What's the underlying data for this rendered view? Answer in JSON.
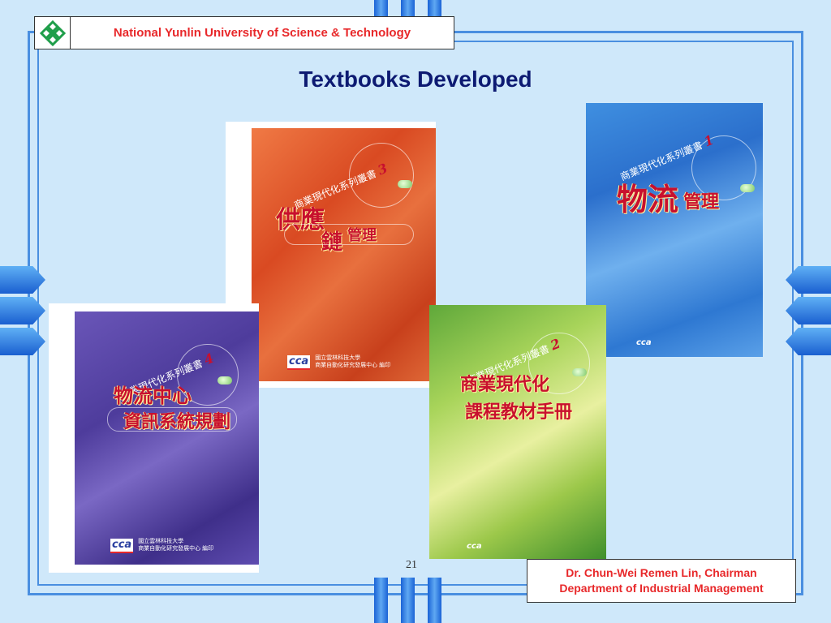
{
  "header": {
    "institution": "National Yunlin University of Science & Technology",
    "logo_icon": "university-flower-logo-icon"
  },
  "title": "Textbooks Developed",
  "books": [
    {
      "series": "商業現代化系列叢書",
      "number": "3",
      "title_big": "供應",
      "title_mid": "鏈",
      "title_small": "管理",
      "publisher_line1": "國立雲林科技大學",
      "publisher_line2": "商業自動化研究發展中心 編印",
      "publisher_logo": "cca",
      "color": "#e0542a"
    },
    {
      "series": "商業現代化系列叢書",
      "number": "1",
      "title_big": "物流",
      "title_small": "管理",
      "publisher_logo": "cca",
      "color": "#2f7fd8"
    },
    {
      "series": "商業現代化系列叢書",
      "number": "4",
      "title_big": "物流中心",
      "title_mid": "資訊系統規劃",
      "publisher_line1": "國立雲林科技大學",
      "publisher_line2": "商業自動化研究發展中心 編印",
      "publisher_logo": "cca",
      "color": "#5b47a8"
    },
    {
      "series": "商業現代化系列叢書",
      "number": "2",
      "title_big": "商業現代化",
      "title_mid": "課程教材手冊",
      "publisher_logo": "cca",
      "color": "#8fc63f"
    }
  ],
  "page_number": "21",
  "footer": {
    "author": "Dr. Chun-Wei Remen Lin, Chairman",
    "department": "Department of Industrial Management"
  },
  "colors": {
    "background": "#cfe8fa",
    "frame": "#4a8fe0",
    "title": "#0d1a72",
    "accent_red": "#e8282a"
  }
}
